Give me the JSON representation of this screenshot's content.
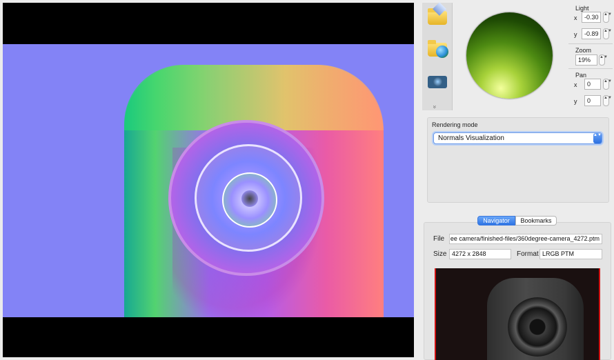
{
  "viewer": {
    "image_name": "360degree-camera normals visualization"
  },
  "toolbar": {
    "tools": [
      {
        "name": "open-file-icon"
      },
      {
        "name": "open-web-icon"
      },
      {
        "name": "snapshot-icon"
      }
    ],
    "more_glyph": "»"
  },
  "light": {
    "label": "Light",
    "x_label": "x",
    "x_value": "-0.30",
    "y_label": "y",
    "y_value": "-0.89"
  },
  "zoom": {
    "label": "Zoom",
    "value": "19%"
  },
  "pan": {
    "label": "Pan",
    "x_label": "x",
    "x_value": "0",
    "y_label": "y",
    "y_value": "0"
  },
  "rendering": {
    "label": "Rendering mode",
    "selected": "Normals Visualization",
    "arrow_glyph": "▲▼"
  },
  "navigator": {
    "tabs": [
      {
        "label": "Navigator",
        "active": true
      },
      {
        "label": "Bookmarks",
        "active": false
      }
    ],
    "file_label": "File",
    "file_value": "ee camera/finished-files/360degree-camera_4272.ptm",
    "size_label": "Size",
    "size_value": "4272 x 2848",
    "format_label": "Format",
    "format_value": "LRGB PTM"
  },
  "stepper_glyph": "▲▼"
}
